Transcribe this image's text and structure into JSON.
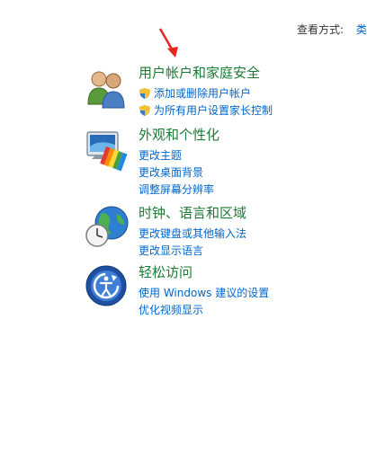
{
  "view_bar": {
    "label": "查看方式:",
    "value": "类别"
  },
  "categories": [
    {
      "title": "用户帐户和家庭安全",
      "icon": "users-icon",
      "links": [
        {
          "text": "添加或删除用户帐户",
          "shield": true
        },
        {
          "text": "为所有用户设置家长控制",
          "shield": true
        }
      ]
    },
    {
      "title": "外观和个性化",
      "icon": "monitor-palette-icon",
      "links": [
        {
          "text": "更改主题"
        },
        {
          "text": "更改桌面背景"
        },
        {
          "text": "调整屏幕分辨率"
        }
      ]
    },
    {
      "title": "时钟、语言和区域",
      "icon": "globe-clock-icon",
      "links": [
        {
          "text": "更改键盘或其他输入法"
        },
        {
          "text": "更改显示语言"
        }
      ]
    },
    {
      "title": "轻松访问",
      "icon": "ease-of-access-icon",
      "links": [
        {
          "text": "使用 Windows 建议的设置"
        },
        {
          "text": "优化视频显示"
        }
      ]
    }
  ],
  "colors": {
    "title": "#1b7a32",
    "link": "#0066cc",
    "arrow": "#e8261e"
  }
}
